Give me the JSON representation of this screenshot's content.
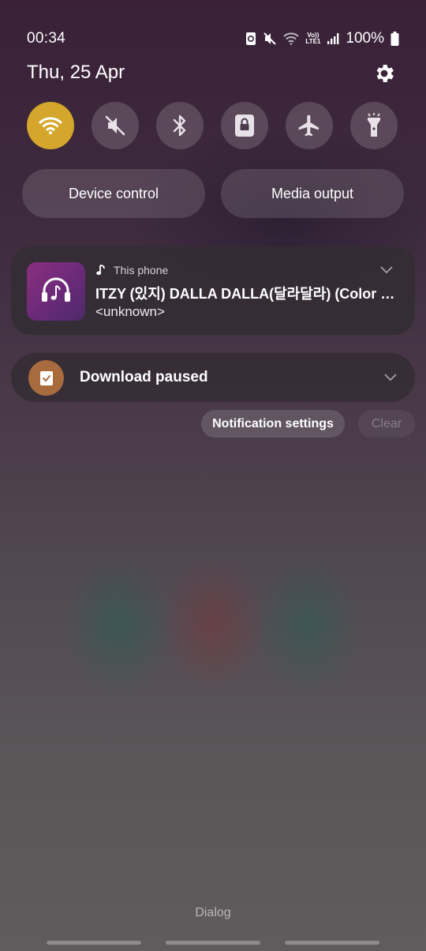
{
  "status_bar": {
    "time": "00:34",
    "battery_text": "100%",
    "network_label_top": "Vo))",
    "network_label_bottom": "LTE1",
    "icons": [
      "android-debug-icon",
      "mute-icon",
      "wifi-icon",
      "volte-lte-icon",
      "signal-icon",
      "battery-icon"
    ]
  },
  "header": {
    "date": "Thu, 25 Apr"
  },
  "quick_settings": {
    "toggles": [
      {
        "name": "wifi",
        "icon": "wifi-icon",
        "state": "on"
      },
      {
        "name": "sound",
        "icon": "mute-icon",
        "state": "off"
      },
      {
        "name": "bluetooth",
        "icon": "bluetooth-icon",
        "state": "off"
      },
      {
        "name": "portrait-lock",
        "icon": "lock-icon",
        "state": "off"
      },
      {
        "name": "airplane-mode",
        "icon": "airplane-icon",
        "state": "off"
      },
      {
        "name": "flashlight",
        "icon": "flashlight-icon",
        "state": "off"
      }
    ],
    "accent_color": "#d4a72c",
    "device_control_label": "Device control",
    "media_output_label": "Media output"
  },
  "media_player": {
    "source": "This phone",
    "title": "ITZY (있지) DALLA DALLA(달라달라) (Color Coded Lyrics Eng/Rom/Han)",
    "artist": "<unknown>"
  },
  "notifications": [
    {
      "text": "Download paused",
      "icon": "download-paused-icon",
      "color": "#a86b3e"
    }
  ],
  "actions": {
    "notification_settings_label": "Notification settings",
    "clear_label": "Clear"
  },
  "background_app": {
    "label": "Dialog"
  }
}
